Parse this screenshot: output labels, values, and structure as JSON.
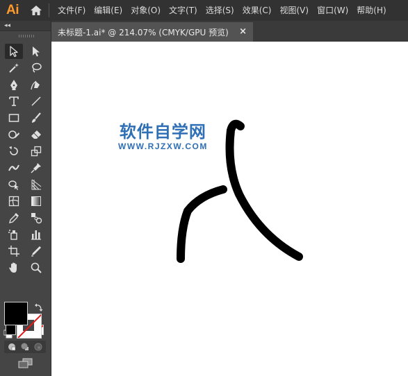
{
  "app": {
    "logo_text": "Ai"
  },
  "menu": {
    "items": [
      "文件(F)",
      "编辑(E)",
      "对象(O)",
      "文字(T)",
      "选择(S)",
      "效果(C)",
      "视图(V)",
      "窗口(W)",
      "帮助(H)"
    ]
  },
  "document_tab": {
    "title": "未标题-1.ai* @ 214.07% (CMYK/GPU 预览)",
    "close_glyph": "×"
  },
  "toolbar": {
    "collapse_glyph": "◂◂"
  },
  "canvas": {
    "watermark": {
      "title": "软件自学网",
      "url": "WWW.RJZXW.COM"
    }
  },
  "colors": {
    "menubar_bg": "#323232",
    "toolbar_bg": "#454545",
    "workspace_bg": "#535353",
    "logo": "#ff9a2d",
    "watermark": "#2f6fb5",
    "fill_color": "#000000",
    "stroke_none": "#e01b1b"
  },
  "icons": {
    "home": "home-icon",
    "selection": "selection-arrow-icon",
    "direct_selection": "direct-selection-icon",
    "magic_wand": "magic-wand-icon",
    "lasso": "lasso-icon",
    "pen": "pen-icon",
    "curvature": "curvature-icon",
    "type": "type-icon",
    "line": "line-segment-icon",
    "rectangle": "rectangle-icon",
    "paintbrush": "paintbrush-icon",
    "shaper": "shaper-icon",
    "eraser": "eraser-icon",
    "rotate": "rotate-icon",
    "scale": "scale-icon",
    "width": "width-icon",
    "puppet_warp": "puppet-warp-icon",
    "shape_builder": "shape-builder-icon",
    "perspective_grid": "perspective-grid-icon",
    "mesh": "mesh-icon",
    "gradient": "gradient-icon",
    "eyedropper": "eyedropper-icon",
    "blend": "blend-icon",
    "symbol_sprayer": "symbol-sprayer-icon",
    "column_graph": "column-graph-icon",
    "artboard": "artboard-icon",
    "slice": "slice-icon",
    "hand": "hand-icon",
    "zoom": "zoom-icon",
    "swap": "swap-fill-stroke-icon",
    "default_colors": "default-colors-icon",
    "draw_normal": "draw-normal-icon",
    "draw_behind": "draw-behind-icon",
    "draw_inside": "draw-inside-icon",
    "screen_mode": "screen-mode-icon"
  }
}
